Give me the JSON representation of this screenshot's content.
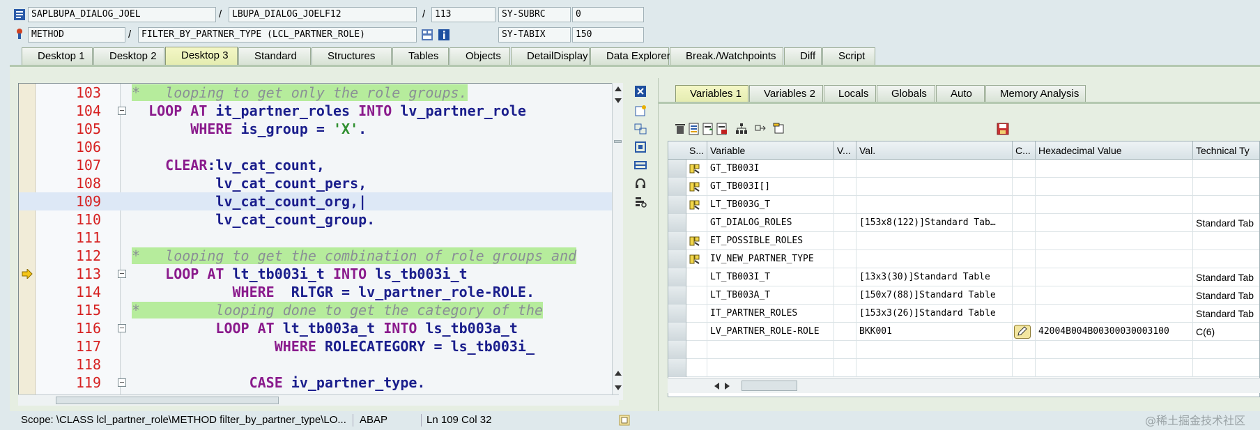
{
  "header": {
    "row1": {
      "program": "SAPLBUPA_DIALOG_JOEL",
      "slash": "/",
      "include": "LBUPA_DIALOG_JOELF12",
      "slash2": "/",
      "line": "113",
      "sysvar_label": "SY-SUBRC",
      "sysvar_value": "0"
    },
    "row2": {
      "type": "METHOD",
      "slash": "/",
      "name": "FILTER_BY_PARTNER_TYPE (LCL_PARTNER_ROLE)",
      "sysvar_label": "SY-TABIX",
      "sysvar_value": "150"
    }
  },
  "tabs": [
    "Desktop 1",
    "Desktop 2",
    "Desktop 3",
    "Standard",
    "Structures",
    "Tables",
    "Objects",
    "DetailDisplay",
    "Data Explorer",
    "Break./Watchpoints",
    "Diff",
    "Script"
  ],
  "active_tab": "Desktop 3",
  "editor": {
    "lines": [
      {
        "no": "103",
        "html": "<span class=\"cmtbg\">*   looping to get only the role groups.</span>",
        "comment": true
      },
      {
        "no": "104",
        "fold": true,
        "html": "  <span class=\"kw\">LOOP AT</span> it_partner_roles <span class=\"kw\">INTO</span> lv_partner_role"
      },
      {
        "no": "105",
        "html": "       <span class=\"kw\">WHERE</span> is_group = <span class=\"str\">'X'</span>."
      },
      {
        "no": "106",
        "html": ""
      },
      {
        "no": "107",
        "html": "    <span class=\"kw\">CLEAR</span>:lv_cat_count,"
      },
      {
        "no": "108",
        "html": "          lv_cat_count_pers,"
      },
      {
        "no": "109",
        "html": "          lv_cat_count_org,|",
        "current": true
      },
      {
        "no": "110",
        "html": "          lv_cat_count_group."
      },
      {
        "no": "111",
        "html": ""
      },
      {
        "no": "112",
        "html": "<span class=\"cmtbg\">*   looping to get the combination of role groups and</span>",
        "comment": true
      },
      {
        "no": "113",
        "fold": true,
        "pointer": true,
        "html": "    <span class=\"kw\">LOOP AT</span> lt_tb003i_t <span class=\"kw\">INTO</span> ls_tb003i_t"
      },
      {
        "no": "114",
        "html": "            <span class=\"kw\">WHERE</span>  RLTGR = lv_partner_role-ROLE."
      },
      {
        "no": "115",
        "html": "<span class=\"cmtbg\">*         looping done to get the category of the</span>",
        "comment": true
      },
      {
        "no": "116",
        "fold": true,
        "html": "          <span class=\"kw\">LOOP AT</span> lt_tb003a_t <span class=\"kw\">INTO</span> ls_tb003a_t"
      },
      {
        "no": "117",
        "html": "                 <span class=\"kw\">WHERE</span> ROLECATEGORY = ls_tb003i_"
      },
      {
        "no": "118",
        "html": ""
      },
      {
        "no": "119",
        "fold": true,
        "html": "              <span class=\"kw\">CASE</span> iv_partner_type."
      }
    ]
  },
  "status": {
    "scope": "Scope: \\CLASS lcl_partner_role\\METHOD filter_by_partner_type\\LO...",
    "lang": "ABAP",
    "pos": "Ln 109 Col  32"
  },
  "right": {
    "tabs": [
      "Variables 1",
      "Variables 2",
      "Locals",
      "Globals",
      "Auto",
      "Memory Analysis"
    ],
    "active_tab": "Variables 1",
    "columns": [
      "S...",
      "Variable",
      "V...",
      "Val.",
      "C...",
      "Hexadecimal Value",
      "Technical Ty"
    ],
    "rows": [
      {
        "icon": true,
        "variable": "GT_TB003I",
        "value": "",
        "hex": "",
        "tech": ""
      },
      {
        "icon": true,
        "variable": "GT_TB003I[]",
        "value": "",
        "hex": "",
        "tech": ""
      },
      {
        "icon": true,
        "variable": "LT_TB003G_T",
        "value": "",
        "hex": "",
        "tech": ""
      },
      {
        "icon": false,
        "variable": "GT_DIALOG_ROLES",
        "value": "[153x8(122)]Standard Tab…",
        "hex": "",
        "tech": "Standard Tab"
      },
      {
        "icon": true,
        "variable": "ET_POSSIBLE_ROLES",
        "value": "",
        "hex": "",
        "tech": ""
      },
      {
        "icon": true,
        "variable": "IV_NEW_PARTNER_TYPE",
        "value": "",
        "hex": "",
        "tech": ""
      },
      {
        "icon": false,
        "variable": "LT_TB003I_T",
        "value": "[13x3(30)]Standard Table",
        "hex": "",
        "tech": "Standard Tab"
      },
      {
        "icon": false,
        "variable": "LT_TB003A_T",
        "value": "[150x7(88)]Standard Table",
        "hex": "",
        "tech": "Standard Tab"
      },
      {
        "icon": false,
        "variable": "IT_PARTNER_ROLES",
        "value": "[153x3(26)]Standard Table",
        "hex": "",
        "tech": "Standard Tab"
      },
      {
        "icon": false,
        "variable": "LV_PARTNER_ROLE-ROLE",
        "value": "BKK001",
        "pencil": true,
        "hex": "42004B004B00300030003100",
        "tech": "C(6)"
      },
      {
        "icon": false,
        "variable": "",
        "value": "",
        "hex": "",
        "tech": ""
      },
      {
        "icon": false,
        "variable": "",
        "value": "",
        "hex": "",
        "tech": ""
      }
    ]
  },
  "watermark": "@稀土掘金技术社区"
}
